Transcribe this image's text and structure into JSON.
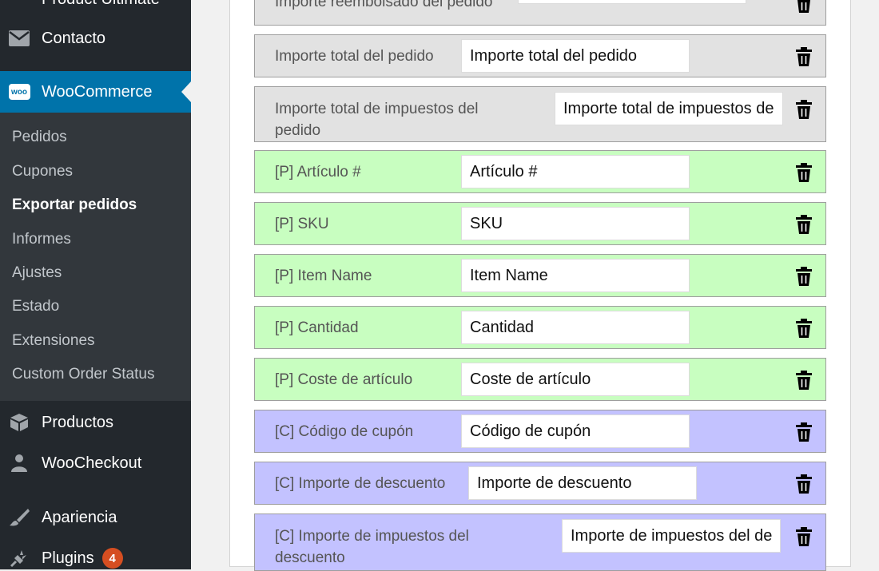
{
  "sidebar": {
    "top_items": [
      {
        "label": "Product Ultimate",
        "icon": "product-icon"
      },
      {
        "label": "Contacto",
        "icon": "envelope-icon"
      },
      {
        "label": "WooCommerce",
        "icon": "woocommerce-icon",
        "icon_text": "woo"
      }
    ],
    "submenu": [
      {
        "label": "Pedidos"
      },
      {
        "label": "Cupones"
      },
      {
        "label": "Exportar pedidos"
      },
      {
        "label": "Informes"
      },
      {
        "label": "Ajustes"
      },
      {
        "label": "Estado"
      },
      {
        "label": "Extensiones"
      },
      {
        "label": "Custom Order Status"
      }
    ],
    "bottom_items": [
      {
        "label": "Productos",
        "icon": "box-icon"
      },
      {
        "label": "WooCheckout",
        "icon": "user-icon"
      },
      {
        "label": "Apariencia",
        "icon": "brush-icon"
      },
      {
        "label": "Plugins",
        "icon": "plug-icon",
        "badge": "4"
      }
    ]
  },
  "fields": [
    {
      "label": "Importe reembolsado del pedido",
      "value": "Importe reembolsado del pedido",
      "color": "grey"
    },
    {
      "label": "Importe total del pedido",
      "value": "Importe total del pedido",
      "color": "grey"
    },
    {
      "label_line1": "Importe total de impuestos del",
      "label_line2": "pedido",
      "value": "Importe total de impuestos del pedido",
      "color": "grey"
    },
    {
      "label": "[P] Artículo #",
      "value": "Artículo #",
      "color": "green"
    },
    {
      "label": "[P] SKU",
      "value": "SKU",
      "color": "green"
    },
    {
      "label": "[P] Item Name",
      "value": "Item Name",
      "color": "green"
    },
    {
      "label": "[P] Cantidad",
      "value": "Cantidad",
      "color": "green"
    },
    {
      "label": "[P] Coste de artículo",
      "value": "Coste de artículo",
      "color": "green"
    },
    {
      "label": "[C] Código de cupón",
      "value": "Código de cupón",
      "color": "purple"
    },
    {
      "label": "[C] Importe de descuento",
      "value": "Importe de descuento",
      "color": "purple"
    },
    {
      "label_line1": "[C] Importe de impuestos del",
      "label_line2": "descuento",
      "value": "Importe de impuestos del descuento",
      "color": "purple"
    }
  ],
  "colors": {
    "grey": "#e2e2e2",
    "green": "#c8fec0",
    "purple": "#c3c2ff",
    "sidebar": "#23282d",
    "accent": "#0073aa"
  }
}
